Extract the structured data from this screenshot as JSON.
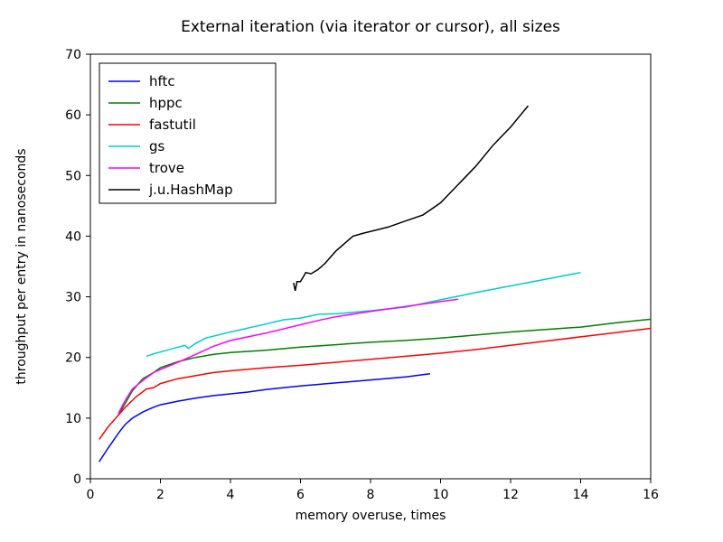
{
  "chart_data": {
    "type": "line",
    "title": "External iteration (via iterator or cursor), all sizes",
    "xlabel": "memory overuse, times",
    "ylabel": "throughput per entry in nanoseconds",
    "xlim": [
      0,
      16
    ],
    "ylim": [
      0,
      70
    ],
    "xticks": [
      0,
      2,
      4,
      6,
      8,
      10,
      12,
      14,
      16
    ],
    "yticks": [
      0,
      10,
      20,
      30,
      40,
      50,
      60,
      70
    ],
    "legend_position": "upper-left",
    "series": [
      {
        "name": "hftc",
        "color": "#0000ff",
        "x": [
          0.25,
          0.5,
          0.8,
          1.0,
          1.2,
          1.5,
          1.8,
          2.0,
          2.5,
          3.0,
          3.5,
          4.0,
          4.5,
          5.0,
          5.5,
          6.0,
          7.0,
          8.0,
          9.0,
          9.7
        ],
        "y": [
          2.8,
          5.0,
          7.5,
          9.0,
          10.0,
          11.0,
          11.8,
          12.2,
          12.8,
          13.3,
          13.7,
          14.0,
          14.3,
          14.7,
          15.0,
          15.3,
          15.8,
          16.3,
          16.8,
          17.3
        ]
      },
      {
        "name": "hppc",
        "color": "#008000",
        "x": [
          0.8,
          1.0,
          1.2,
          1.5,
          1.8,
          2.0,
          2.5,
          3.0,
          3.5,
          4.0,
          5.0,
          6.0,
          7.0,
          8.0,
          9.0,
          10.0,
          11.0,
          12.0,
          13.0,
          14.0,
          15.0,
          16.0
        ],
        "y": [
          10.5,
          12.5,
          14.5,
          16.5,
          17.5,
          18.3,
          19.3,
          20.0,
          20.5,
          20.8,
          21.2,
          21.7,
          22.1,
          22.5,
          22.8,
          23.2,
          23.7,
          24.2,
          24.6,
          25.0,
          25.7,
          26.3
        ]
      },
      {
        "name": "fastutil",
        "color": "#ff0000",
        "x": [
          0.25,
          0.5,
          0.8,
          1.0,
          1.3,
          1.6,
          1.8,
          2.0,
          2.5,
          3.0,
          3.5,
          4.0,
          5.0,
          6.0,
          7.0,
          8.0,
          9.0,
          10.0,
          11.0,
          12.0,
          13.0,
          14.0,
          15.0,
          16.0
        ],
        "y": [
          6.5,
          8.5,
          10.5,
          11.8,
          13.5,
          14.8,
          15.0,
          15.7,
          16.5,
          17.0,
          17.5,
          17.8,
          18.3,
          18.7,
          19.2,
          19.7,
          20.2,
          20.7,
          21.3,
          22.0,
          22.7,
          23.4,
          24.1,
          24.8
        ]
      },
      {
        "name": "gs",
        "color": "#00cccc",
        "x": [
          1.6,
          1.8,
          2.0,
          2.5,
          2.7,
          2.8,
          3.0,
          3.3,
          4.0,
          5.0,
          5.5,
          6.0,
          6.5,
          7.0,
          8.0,
          9.0,
          10.0,
          11.0,
          12.0,
          13.0,
          14.0
        ],
        "y": [
          20.2,
          20.6,
          20.9,
          21.7,
          22.0,
          21.5,
          22.3,
          23.2,
          24.2,
          25.5,
          26.2,
          26.5,
          27.1,
          27.2,
          27.7,
          28.3,
          29.5,
          30.7,
          31.8,
          32.9,
          34.0
        ]
      },
      {
        "name": "trove",
        "color": "#ff00ff",
        "x": [
          0.8,
          1.0,
          1.2,
          1.5,
          1.8,
          2.0,
          2.5,
          3.0,
          3.5,
          4.0,
          4.5,
          5.0,
          5.5,
          6.0,
          6.5,
          7.0,
          8.0,
          9.0,
          10.0,
          10.5
        ],
        "y": [
          10.8,
          13.0,
          14.8,
          16.2,
          17.5,
          18.0,
          19.2,
          20.5,
          21.8,
          22.8,
          23.4,
          24.0,
          24.7,
          25.4,
          26.1,
          26.7,
          27.6,
          28.4,
          29.2,
          29.6
        ]
      },
      {
        "name": "j.u.HashMap",
        "color": "#000000",
        "x": [
          5.8,
          5.85,
          5.9,
          6.0,
          6.15,
          6.3,
          6.5,
          6.7,
          7.0,
          7.2,
          7.5,
          7.8,
          8.5,
          9.0,
          9.5,
          10.0,
          10.5,
          11.0,
          11.5,
          12.0,
          12.5
        ],
        "y": [
          32.3,
          31.0,
          32.5,
          32.5,
          34.0,
          33.8,
          34.5,
          35.5,
          37.5,
          38.5,
          40.0,
          40.5,
          41.5,
          42.5,
          43.5,
          45.5,
          48.5,
          51.5,
          55.0,
          58.0,
          61.5
        ]
      }
    ]
  }
}
